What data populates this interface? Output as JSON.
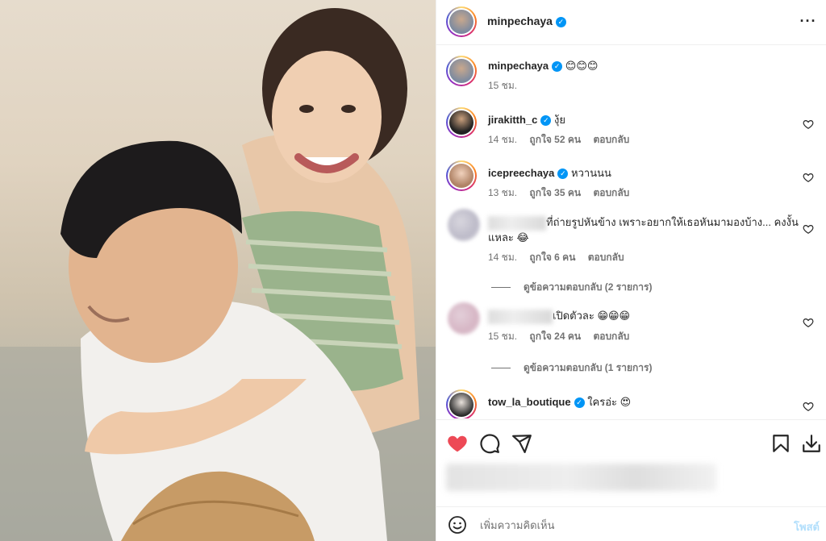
{
  "post": {
    "author": "minpechaya",
    "caption": "😊😊😊",
    "caption_time": "15 ชม."
  },
  "comments": [
    {
      "username": "jirakitth_c",
      "text": "งุ้ย",
      "time": "14 ชม.",
      "likes": "ถูกใจ 52 คน",
      "reply": "ตอบกลับ"
    },
    {
      "username": "icepreechaya",
      "text": "หวานนน",
      "time": "13 ชม.",
      "likes": "ถูกใจ 35 คน",
      "reply": "ตอบกลับ"
    },
    {
      "text_line1": "ที่ถ่ายรูปหันข้าง เพราะอยากให้เธอหันมามองบ้าง... คงงั้น",
      "text_line2": "แหละ 😂",
      "time": "14 ชม.",
      "likes": "ถูกใจ 6 คน",
      "reply": "ตอบกลับ",
      "view_replies": "ดูข้อความตอบกลับ (2 รายการ)"
    },
    {
      "text": "เปิดตัวละ 😁😁😁",
      "time": "15 ชม.",
      "likes": "ถูกใจ 24 คน",
      "reply": "ตอบกลับ",
      "view_replies": "ดูข้อความตอบกลับ (1 รายการ)"
    },
    {
      "username": "tow_la_boutique",
      "text": "ใครอ่ะ 😍"
    }
  ],
  "comment_box": {
    "placeholder": "เพิ่มความคิดเห็น",
    "post_label": "โพสต์"
  },
  "icons": {
    "more": "more-options-icon",
    "like": "heart-icon",
    "comment": "comment-icon",
    "share": "share-icon",
    "save": "bookmark-icon",
    "download": "download-icon",
    "emoji": "emoji-icon"
  },
  "colors": {
    "liked_heart": "#ed4956",
    "verified": "#0095f6",
    "post_button_disabled": "#b2dffc"
  }
}
